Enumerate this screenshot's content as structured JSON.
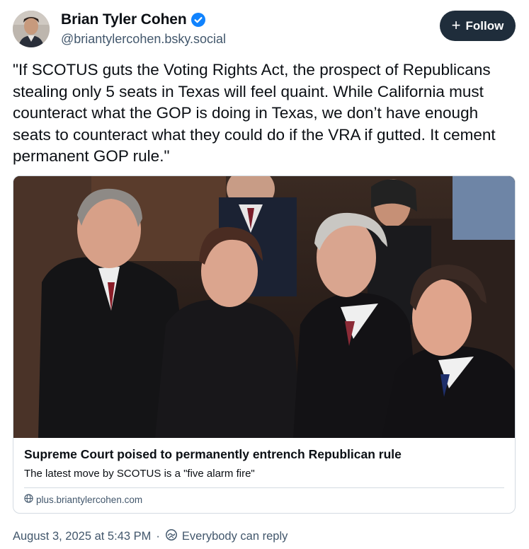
{
  "author": {
    "display_name": "Brian Tyler Cohen",
    "handle": "@briantylercohen.bsky.social",
    "verified": true
  },
  "follow_button": {
    "icon": "plus-icon",
    "label": "Follow"
  },
  "post": {
    "text": "\"If SCOTUS guts the Voting Rights Act, the prospect of Republicans stealing only 5 seats in Texas will feel quaint. While California must counteract what the GOP is doing in Texas, we don’t have enough seats to counteract what they could do if the VRA if gutted. It cement permanent GOP rule.\""
  },
  "embed": {
    "image_description": "photo-of-justices",
    "title": "Supreme Court poised to permanently entrench Republican rule",
    "description": "The latest move by SCOTUS is a \"five alarm fire\"",
    "domain_icon": "globe-icon",
    "domain": "plus.briantylercohen.com"
  },
  "footer": {
    "timestamp": "August 3, 2025 at 5:43 PM",
    "separator": "·",
    "reply_icon": "reply-permission-icon",
    "reply_setting": "Everybody can reply"
  },
  "colors": {
    "text_primary": "#0b0f14",
    "text_secondary": "#42576c",
    "follow_bg": "#1f2d3b",
    "verified_blue": "#1083fe",
    "border": "#d4dbe2"
  }
}
